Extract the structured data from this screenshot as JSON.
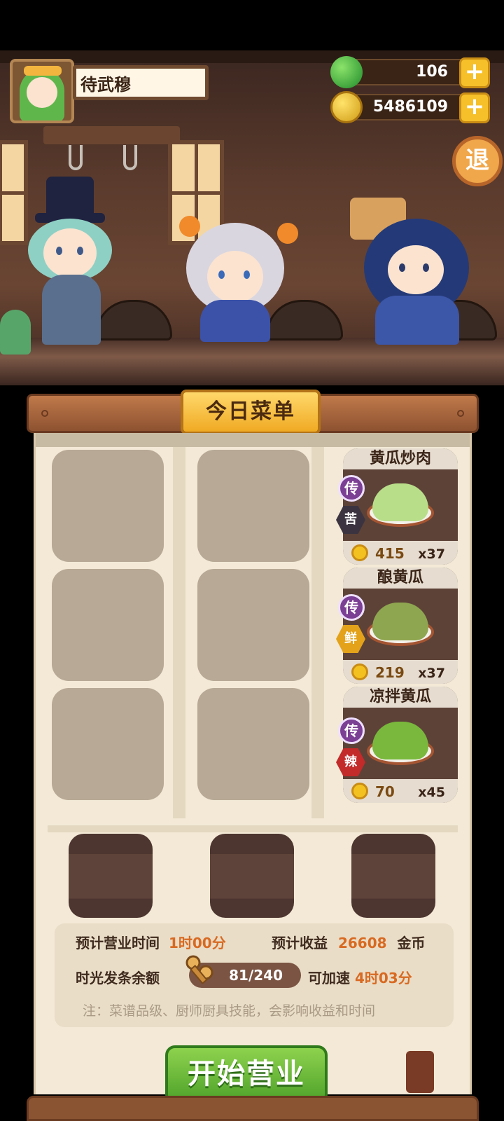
{
  "player": {
    "name": "待武穆"
  },
  "resources": {
    "gems": "106",
    "coins": "5486109"
  },
  "exit_label": "退",
  "menu": {
    "title": "今日菜单",
    "dishes": [
      {
        "name": "黄瓜炒肉",
        "rank": "传",
        "flavor": "苦",
        "flavor_color": "#3b3440",
        "price": "415",
        "qty": "x37"
      },
      {
        "name": "酿黄瓜",
        "rank": "传",
        "flavor": "鲜",
        "flavor_color": "#e3a21a",
        "price": "219",
        "qty": "x37"
      },
      {
        "name": "凉拌黄瓜",
        "rank": "传",
        "flavor": "辣",
        "flavor_color": "#c32a2a",
        "price": "70",
        "qty": "x45"
      }
    ]
  },
  "info": {
    "time_label": "预计营业时间",
    "time_value": "1时00分",
    "income_label": "预计收益",
    "income_value": "26608",
    "income_unit": "金币",
    "spring_label": "时光发条余额",
    "spring_value": "81/240",
    "speedup_label": "可加速",
    "speedup_value": "4时03分",
    "note": "注：菜谱品级、厨师厨具技能，会影响收益和时间"
  },
  "start_button": "开始营业",
  "colors": {
    "accent_orange": "#d86a22",
    "start_green": "#4ea22a",
    "rank_purple": "#7b3f93"
  }
}
